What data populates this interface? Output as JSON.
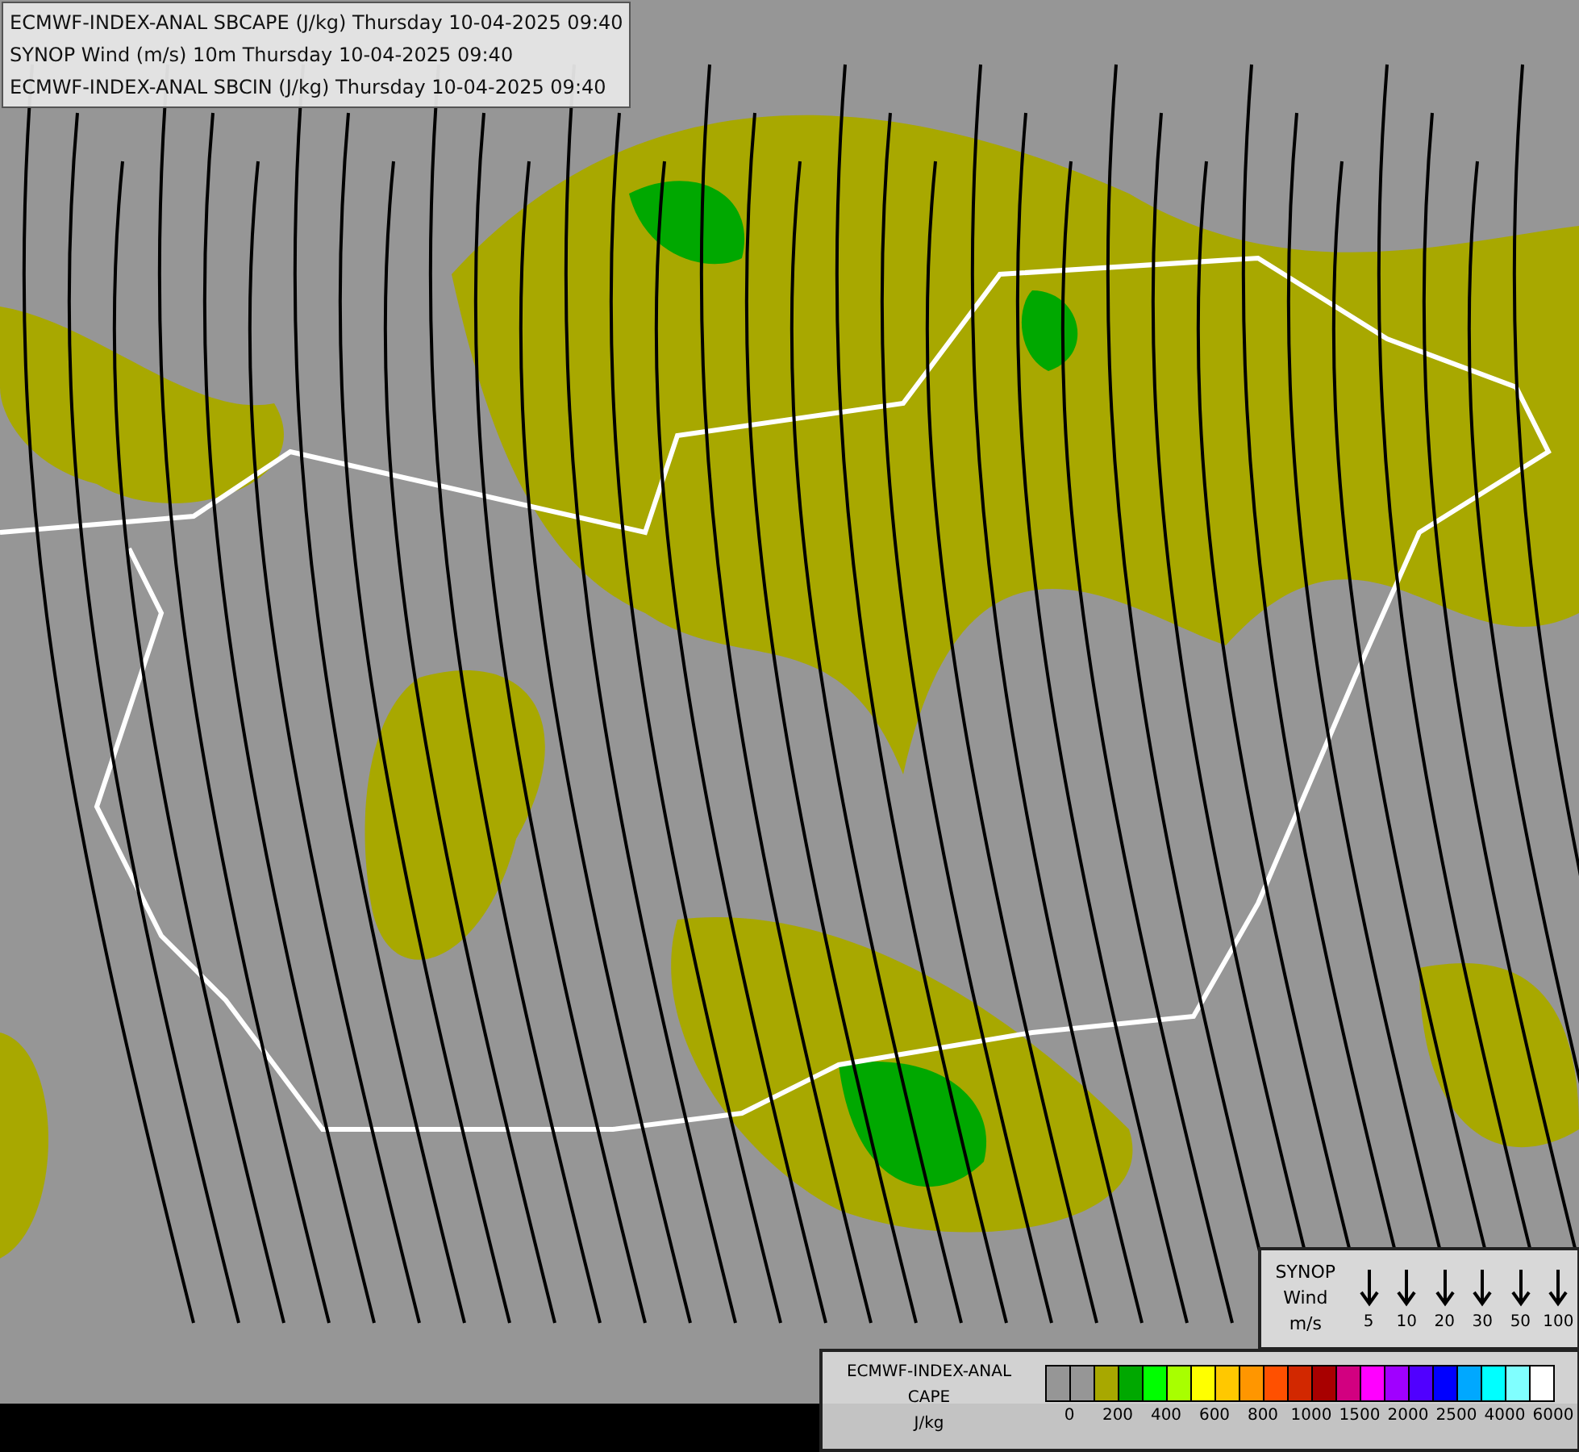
{
  "header_lines": [
    "ECMWF-INDEX-ANAL SBCAPE (J/kg) Thursday 10-04-2025 09:40",
    "SYNOP Wind (m/s) 10m Thursday 10-04-2025 09:40",
    "ECMWF-INDEX-ANAL SBCIN (J/kg) Thursday 10-04-2025 09:40"
  ],
  "wind_legend": {
    "title_lines": [
      "SYNOP",
      "Wind",
      "m/s"
    ],
    "speeds": [
      "5",
      "10",
      "20",
      "30",
      "50",
      "100"
    ]
  },
  "cape_legend": {
    "title_lines": [
      "ECMWF-INDEX-ANAL",
      "CAPE",
      "J/kg"
    ],
    "swatches": [
      {
        "color": "#969696",
        "tick": "0"
      },
      {
        "color": "#969696"
      },
      {
        "color": "#a8a800",
        "tick": "200"
      },
      {
        "color": "#00a800"
      },
      {
        "color": "#00ff00",
        "tick": "400"
      },
      {
        "color": "#a8ff00"
      },
      {
        "color": "#ffff00",
        "tick": "600"
      },
      {
        "color": "#ffc800"
      },
      {
        "color": "#ff9600",
        "tick": "800"
      },
      {
        "color": "#ff5000"
      },
      {
        "color": "#d22800",
        "tick": "1000"
      },
      {
        "color": "#a80000"
      },
      {
        "color": "#d20080",
        "tick": "1500"
      },
      {
        "color": "#ff00ff"
      },
      {
        "color": "#a000ff",
        "tick": "2000"
      },
      {
        "color": "#5000ff"
      },
      {
        "color": "#0000ff",
        "tick": "2500"
      },
      {
        "color": "#00a8ff"
      },
      {
        "color": "#00ffff",
        "tick": "4000"
      },
      {
        "color": "#80ffff"
      },
      {
        "color": "#ffffff",
        "tick": "6000"
      }
    ]
  }
}
